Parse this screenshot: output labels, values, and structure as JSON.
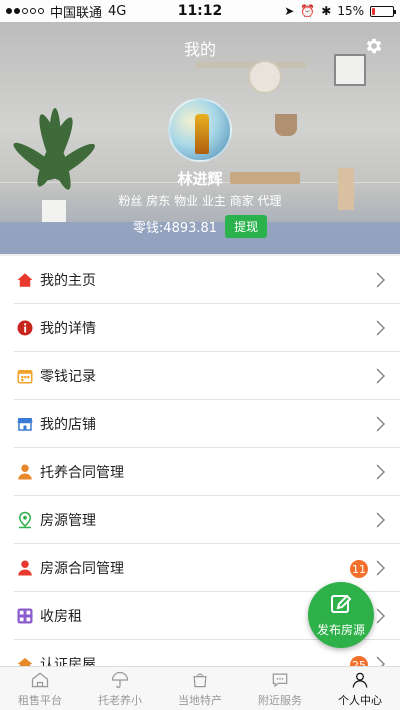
{
  "status_bar": {
    "carrier": "中国联通",
    "network": "4G",
    "time": "11:12",
    "battery": "15%",
    "battery_level": 0.15
  },
  "header": {
    "title": "我的",
    "user_name": "林进辉",
    "roles": "粉丝 房东 物业 业主 商家 代理",
    "balance": "零钱:4893.81",
    "withdraw_label": "提现"
  },
  "menu": {
    "items": [
      {
        "label": "我的主页",
        "icon": "home-icon",
        "color": "#e8392f"
      },
      {
        "label": "我的详情",
        "icon": "info-icon",
        "color": "#c8261d"
      },
      {
        "label": "零钱记录",
        "icon": "calendar-icon",
        "color": "#f0a22a"
      },
      {
        "label": "我的店铺",
        "icon": "store-icon",
        "color": "#3a7bd5"
      },
      {
        "label": "托养合同管理",
        "icon": "person-icon",
        "color": "#e8882a"
      },
      {
        "label": "房源管理",
        "icon": "location-icon",
        "color": "#2fb149"
      },
      {
        "label": "房源合同管理",
        "icon": "person-icon",
        "color": "#e8392f",
        "badge": "11"
      },
      {
        "label": "收房租",
        "icon": "grid-icon",
        "color": "#8a5cd0"
      },
      {
        "label": "认证房屋",
        "icon": "house-icon",
        "color": "#e8882a",
        "badge": "25"
      }
    ]
  },
  "fab": {
    "label": "发布房源"
  },
  "tabbar": {
    "tabs": [
      {
        "label": "租售平台"
      },
      {
        "label": "托老养小"
      },
      {
        "label": "当地特产"
      },
      {
        "label": "附近服务"
      },
      {
        "label": "个人中心"
      }
    ]
  },
  "colors": {
    "accent": "#2fb149",
    "badge": "#f4702a"
  }
}
